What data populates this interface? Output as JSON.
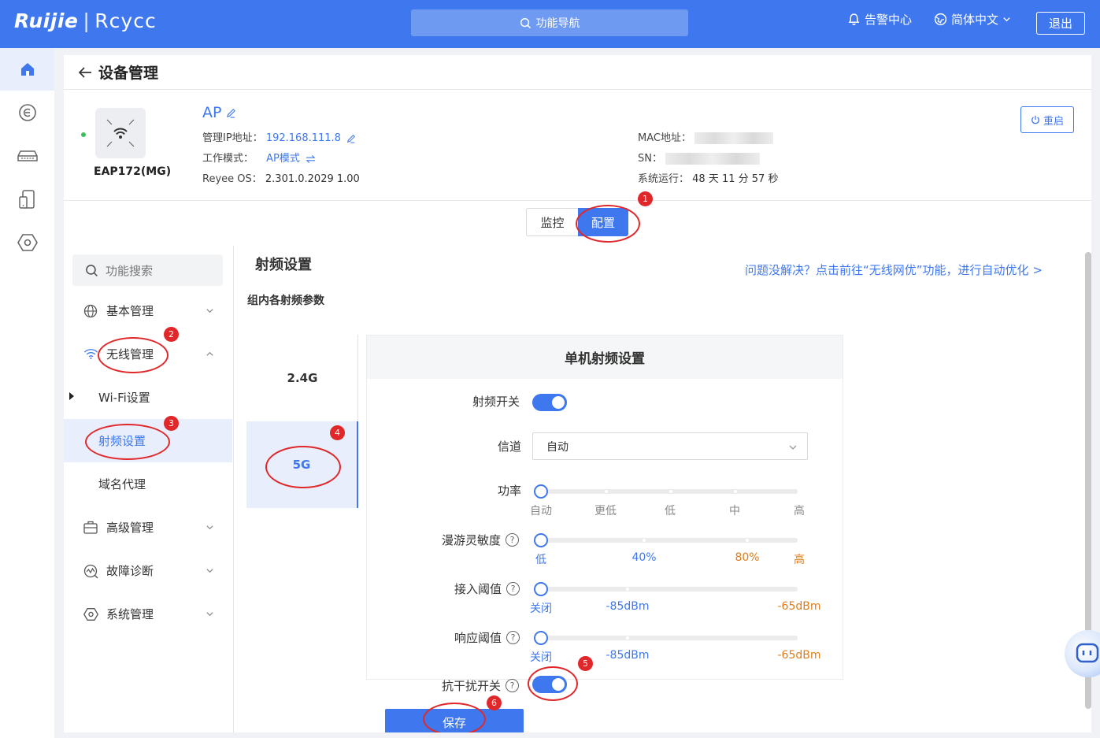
{
  "topbar": {
    "logo_brand": "Ruijie",
    "logo_product": "Rcycc",
    "search_label": "功能导航",
    "alarm_label": "告警中心",
    "language_label": "简体中文",
    "logout_label": "退出"
  },
  "colors": {
    "accent": "#3f78ee",
    "annotation": "#e0282a",
    "status_online": "#3cbf5a",
    "orange": "#e07c1a"
  },
  "leftnav": {
    "items": [
      {
        "name": "home-icon",
        "active": true
      },
      {
        "name": "network-icon",
        "active": false
      },
      {
        "name": "switch-device-icon",
        "active": false
      },
      {
        "name": "client-devices-icon",
        "active": false
      },
      {
        "name": "settings-hex-icon",
        "active": false
      }
    ]
  },
  "page": {
    "title": "设备管理"
  },
  "device": {
    "model": "EAP172(MG)",
    "name": "AP",
    "ip_label": "管理IP地址：",
    "ip_value": "192.168.111.8",
    "mode_label": "工作模式：",
    "mode_value": "AP模式",
    "os_label": "Reyee OS：",
    "os_value": "2.301.0.2029 1.00",
    "mac_label": "MAC地址：",
    "sn_label": "SN：",
    "uptime_label": "系统运行：",
    "uptime_value": "48 天 11 分 57 秒",
    "restart_label": "重启"
  },
  "view_tabs": {
    "monitor": "监控",
    "config": "配置"
  },
  "sidebar": {
    "search_placeholder": "功能搜索",
    "items": [
      {
        "label": "基本管理",
        "expanded": false
      },
      {
        "label": "无线管理",
        "expanded": true
      },
      {
        "label": "Wi-Fi设置"
      },
      {
        "label": "射频设置",
        "selected": true
      },
      {
        "label": "域名代理"
      },
      {
        "label": "高级管理",
        "expanded": false
      },
      {
        "label": "故障诊断",
        "expanded": false
      },
      {
        "label": "系统管理",
        "expanded": false
      }
    ]
  },
  "content": {
    "section_title": "射频设置",
    "help_link": "问题没解决？点击前往“无线网优”功能，进行自动优化 >",
    "group_title": "组内各射频参数",
    "bands": [
      "2.4G",
      "5G"
    ],
    "selected_band": "5G",
    "panel_title": "单机射频设置",
    "fields": {
      "radio_switch": {
        "label": "射频开关",
        "on": true
      },
      "channel": {
        "label": "信道",
        "value": "自动"
      },
      "power": {
        "label": "功率",
        "ticks": [
          "自动",
          "更低",
          "低",
          "中",
          "高"
        ],
        "selected": "自动"
      },
      "roaming": {
        "label": "漫游灵敏度",
        "ticks": [
          "低",
          "40%",
          "80%",
          "高"
        ],
        "selected": "低"
      },
      "access_threshold": {
        "label": "接入阈值",
        "ticks": [
          "关闭",
          "-85dBm",
          "-65dBm"
        ],
        "selected": "关闭"
      },
      "response_threshold": {
        "label": "响应阈值",
        "ticks": [
          "关闭",
          "-85dBm",
          "-65dBm"
        ],
        "selected": "关闭"
      },
      "anti_interference": {
        "label": "抗干扰开关",
        "on": true
      }
    },
    "save_label": "保存"
  },
  "annotations": [
    "1",
    "2",
    "3",
    "4",
    "5",
    "6"
  ]
}
